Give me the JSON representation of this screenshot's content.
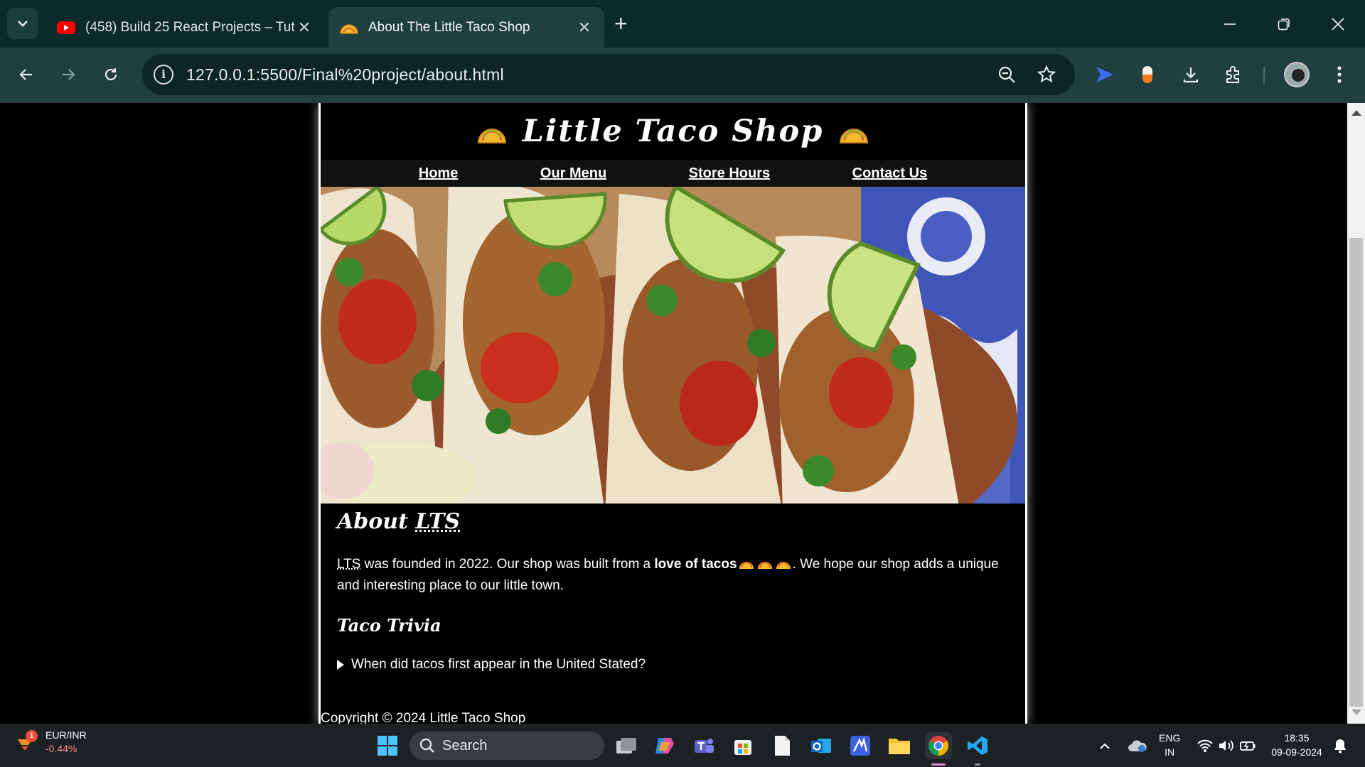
{
  "browser": {
    "tabs": [
      {
        "title": "(458) Build 25 React Projects – Tut",
        "active": false,
        "icon": "youtube-icon"
      },
      {
        "title": "About The Little Taco Shop",
        "active": true,
        "icon": "taco-icon"
      }
    ],
    "url": "127.0.0.1:5500/Final%20project/about.html"
  },
  "site": {
    "title": "Little Taco Shop",
    "nav": [
      "Home",
      "Our Menu",
      "Store Hours",
      "Contact Us"
    ],
    "about_heading_prefix": "About ",
    "about_heading_abbr": "LTS",
    "para_abbr": "LTS",
    "para_text_1": " was founded in 2022. Our shop was built from a ",
    "para_bold": "love of tacos",
    "para_text_2": ". We hope our shop adds a unique and interesting place to our little town.",
    "trivia_heading": "Taco Trivia",
    "trivia_question": "When did tacos first appear in the United Stated?",
    "footer": "Copyright © 2024 Little Taco Shop"
  },
  "taskbar": {
    "stock_name": "EUR/INR",
    "stock_change": "-0.44%",
    "badge": "1",
    "search_placeholder": "Search",
    "lang_top": "ENG",
    "lang_bottom": "IN",
    "time": "18:35",
    "date": "09-09-2024"
  },
  "colors": {
    "accent_tab": "#1f3f40",
    "taco": "#f5b82e",
    "chrome_dark": "#0d2a2b"
  }
}
